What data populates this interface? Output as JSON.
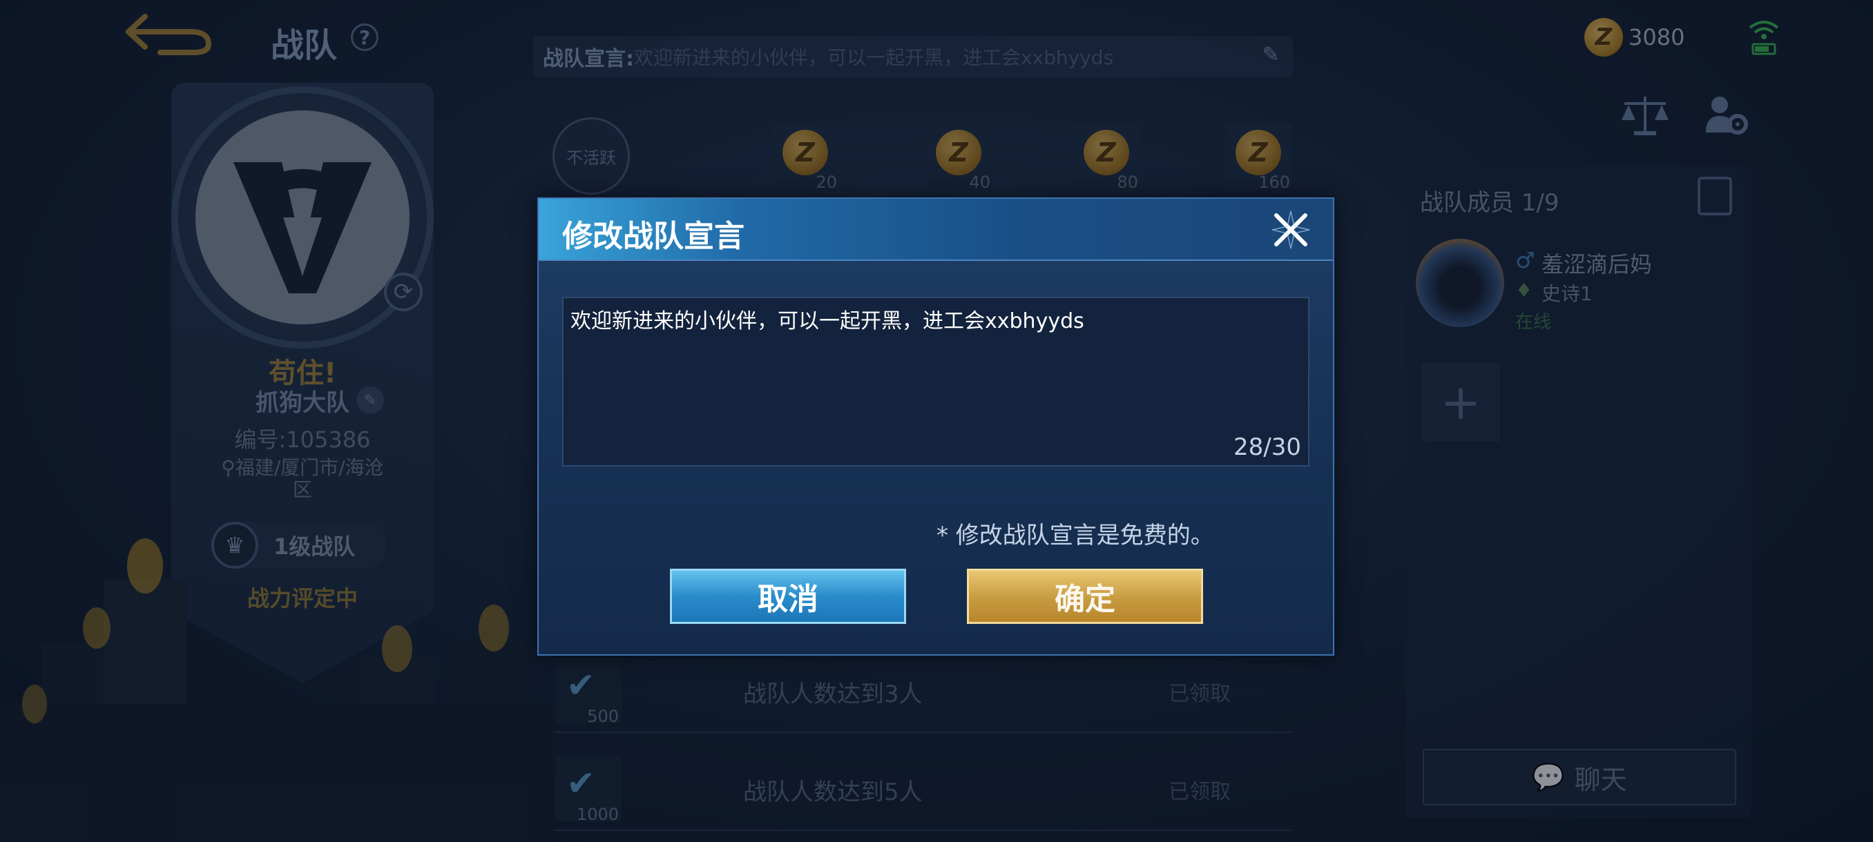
{
  "page": {
    "title": "战队",
    "help": "?"
  },
  "team": {
    "slogan": "苟住!",
    "name": "抓狗大队",
    "id_text": "编号:105386",
    "location": "福建/厦门市/海沧区",
    "level": "1级战队",
    "power": "战力评定中"
  },
  "declaration": {
    "label": "战队宣言:",
    "value": "欢迎新进来的小伙伴，可以一起开黑，进工会xxbhyyds"
  },
  "activity": {
    "inactive_label": "不活跃",
    "rewards": [
      "20",
      "40",
      "80",
      "160"
    ]
  },
  "tasks": [
    {
      "title": "战队人数达到3人",
      "reward": "500",
      "status": "已领取"
    },
    {
      "title": "战队人数达到5人",
      "reward": "1000",
      "status": "已领取"
    }
  ],
  "currency": {
    "value": "3080"
  },
  "members": {
    "title": "战队成员 1/9",
    "list": [
      {
        "name": "羞涩滴后妈",
        "gender": "♂",
        "rank": "史诗1",
        "status": "在线"
      }
    ],
    "chat_label": "聊天"
  },
  "modal": {
    "title": "修改战队宣言",
    "text_value": "欢迎新进来的小伙伴，可以一起开黑，进工会xxbhyyds",
    "char_count": "28/30",
    "note": "* 修改战队宣言是免费的。",
    "cancel_label": "取消",
    "confirm_label": "确定"
  },
  "colors": {
    "accent_blue": "#2a8ccb",
    "accent_gold": "#c79b3f",
    "modal_bg": "#173154"
  }
}
